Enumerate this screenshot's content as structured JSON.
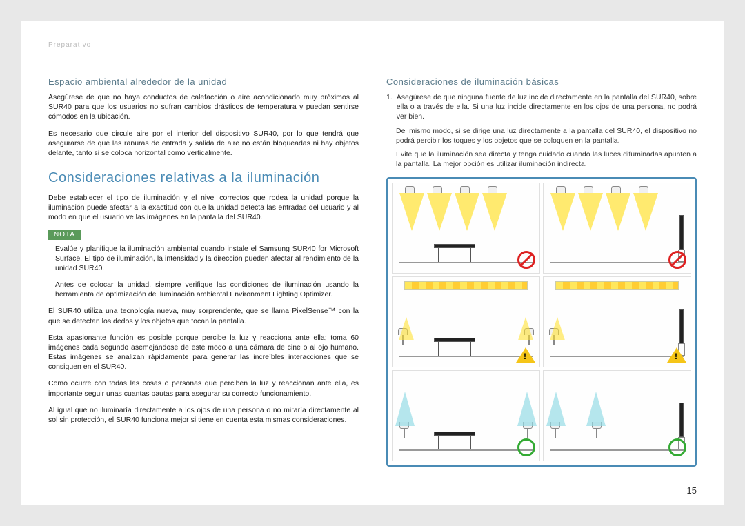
{
  "breadcrumb": "Preparativo",
  "left": {
    "h1": "Espacio ambiental alrededor de la unidad",
    "p1": "Asegúrese de que no haya conductos de calefacción o aire acondicionado muy próximos al SUR40 para que los usuarios no sufran cambios drásticos de temperatura y puedan sentirse cómodos en la ubicación.",
    "p2": "Es necesario que circule aire por el interior del dispositivo SUR40, por lo que tendrá que asegurarse de que las ranuras de entrada y salida de aire no están bloqueadas ni hay objetos delante, tanto si se coloca horizontal como verticalmente.",
    "h2": "Consideraciones relativas a la iluminación",
    "p3": "Debe establecer el tipo de iluminación y el nivel correctos que rodea la unidad porque la iluminación puede afectar a la exactitud con que la unidad detecta las entradas del usuario y al modo en que el usuario ve las imágenes en la pantalla del SUR40.",
    "nota": "NOTA",
    "n1": "Evalúe y planifique la iluminación ambiental cuando instale el Samsung SUR40 for Microsoft Surface. El tipo de iluminación, la intensidad y la dirección pueden afectar al rendimiento de la unidad SUR40.",
    "n2": "Antes de colocar la unidad, siempre verifique las condiciones de iluminación usando la herramienta de optimización de iluminación ambiental Environment Lighting Optimizer.",
    "p4": "El SUR40 utiliza una tecnología nueva, muy sorprendente, que se llama PixelSense™ con la que se detectan los dedos y los objetos que tocan la pantalla.",
    "p5": "Esta apasionante función es posible porque percibe la luz y reacciona ante ella; toma 60 imágenes cada segundo asemejándose de este modo a una cámara de cine o al ojo humano. Estas imágenes se analizan rápidamente para generar las increíbles interacciones que se consiguen en el SUR40.",
    "p6": "Como ocurre con todas las cosas o personas que perciben la luz y reaccionan ante ella, es importante seguir unas cuantas pautas para asegurar su correcto funcionamiento.",
    "p7": "Al igual que no iluminaría directamente a los ojos de una persona o no miraría directamente al sol sin protección, el SUR40 funciona mejor si tiene en cuenta esta mismas consideraciones."
  },
  "right": {
    "h1": "Consideraciones de iluminación básicas",
    "num1": "1.",
    "li1": "Asegúrese de que ninguna fuente de luz incide directamente en la pantalla del SUR40, sobre ella o a través de ella. Si una luz incide directamente en los ojos de una persona, no podrá ver bien.",
    "li1b": "Del mismo modo, si se dirige una luz directamente a la pantalla del SUR40, el dispositivo no podrá percibir los toques y los objetos que se coloquen en la pantalla.",
    "li1c": "Evite que la iluminación sea directa y tenga cuidado cuando las luces difuminadas apunten a la pantalla. La mejor opción es utilizar iluminación indirecta."
  },
  "pageNum": "15"
}
